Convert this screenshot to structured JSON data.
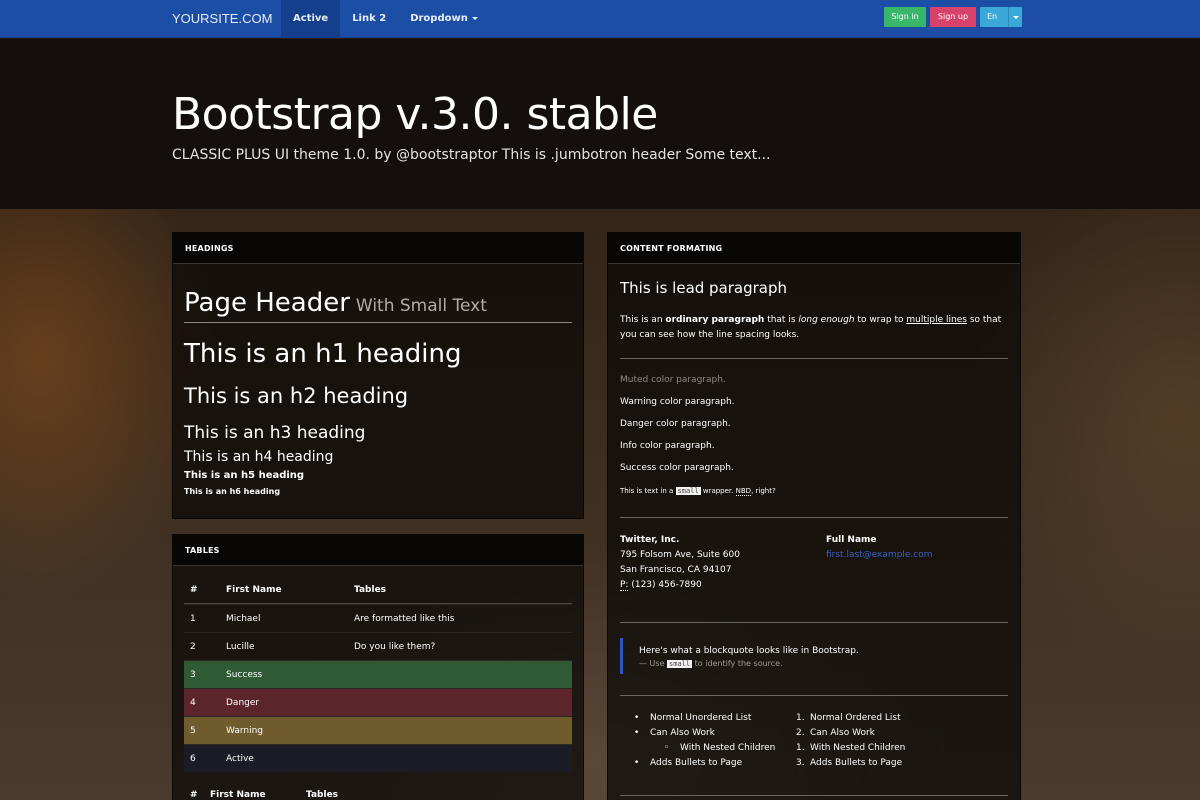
{
  "navbar": {
    "brand": "YOURSITE.COM",
    "links": [
      "Active",
      "Link 2",
      "Dropdown"
    ],
    "signin": "Sign in",
    "signup": "Sign up",
    "lang": "En"
  },
  "jumbotron": {
    "title": "Bootstrap v.3.0. stable",
    "subtitle": "CLASSIC PLUS UI theme 1.0. by @bootstraptor This is .jumbotron header Some text..."
  },
  "headings_panel": {
    "title": "HEADINGS",
    "page_header": "Page Header",
    "page_header_small": "With Small Text",
    "h1": "This is an h1 heading",
    "h2": "This is an h2 heading",
    "h3": "This is an h3 heading",
    "h4": "This is an h4 heading",
    "h5": "This is an h5 heading",
    "h6": "This is an h6 heading"
  },
  "tables_panel": {
    "title": "TABLES",
    "headers": [
      "#",
      "First Name",
      "Tables"
    ],
    "rows": [
      {
        "n": "1",
        "name": "Michael",
        "text": "Are formatted like this"
      },
      {
        "n": "2",
        "name": "Lucille",
        "text": "Do you like them?"
      },
      {
        "n": "3",
        "name": "Success",
        "text": ""
      },
      {
        "n": "4",
        "name": "Danger",
        "text": ""
      },
      {
        "n": "5",
        "name": "Warning",
        "text": ""
      },
      {
        "n": "6",
        "name": "Active",
        "text": ""
      }
    ],
    "headers2": [
      "#",
      "First Name",
      "Tables"
    ]
  },
  "content_panel": {
    "title": "CONTENT FORMATING",
    "lead": "This is lead paragraph",
    "ordinary_1": "This is an",
    "ordinary_bold": "ordinary paragraph",
    "ordinary_2": "that is",
    "ordinary_em": "long enough",
    "ordinary_3": "to wrap to",
    "ordinary_u": "multiple lines",
    "ordinary_4": "so that you can see how the line spacing looks.",
    "muted": "Muted color paragraph.",
    "warning": "Warning color paragraph.",
    "danger": "Danger color paragraph.",
    "info": "Info color paragraph.",
    "success": "Success color paragraph.",
    "small_1": "This is text in a",
    "small_code": "small",
    "small_2": "wrapper.",
    "small_abbr": "NBD",
    "small_3": ", right?",
    "address": {
      "company": "Twitter, Inc.",
      "line1": "795 Folsom Ave, Suite 600",
      "line2": "San Francisco, CA 94107",
      "phone_label": "P:",
      "phone": "(123) 456-7890"
    },
    "address2": {
      "name": "Full Name",
      "email": "first.last@example.com"
    },
    "blockquote": {
      "text": "Here's what a blockquote looks like in Bootstrap.",
      "foot_1": "— Use",
      "foot_code": "small",
      "foot_2": "to identify the source."
    },
    "ul": [
      "Normal Unordered List",
      "Can Also Work",
      "With Nested Children",
      "Adds Bullets to Page"
    ],
    "ol": [
      "Normal Ordered List",
      "Can Also Work",
      "With Nested Children",
      "Adds Bullets to Page"
    ],
    "ol_nums": [
      "1.",
      "2.",
      "1.",
      "3."
    ]
  }
}
